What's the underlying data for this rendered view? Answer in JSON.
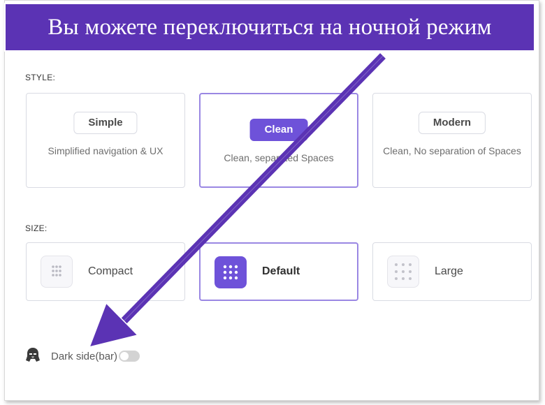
{
  "banner": {
    "text": "Вы можете переключиться на ночной режим"
  },
  "style_section": {
    "label": "STYLE:",
    "cards": [
      {
        "name": "Simple",
        "description": "Simplified navigation & UX",
        "selected": false
      },
      {
        "name": "Clean",
        "description": "Clean, separated Spaces",
        "selected": true
      },
      {
        "name": "Modern",
        "description": "Clean, No separation of Spaces",
        "selected": false
      }
    ]
  },
  "size_section": {
    "label": "SIZE:",
    "cards": [
      {
        "name": "Compact",
        "icon": "compact-grid-icon",
        "selected": false
      },
      {
        "name": "Default",
        "icon": "default-grid-icon",
        "selected": true
      },
      {
        "name": "Large",
        "icon": "large-grid-icon",
        "selected": false
      }
    ]
  },
  "dark_sidebar": {
    "label": "Dark side(bar)",
    "icon": "darth-vader-icon",
    "enabled": false
  },
  "colors": {
    "banner": "#5b33b4",
    "accent": "#6e52d9",
    "arrow": "#5b33b4",
    "selected_border": "#9a87e3"
  }
}
